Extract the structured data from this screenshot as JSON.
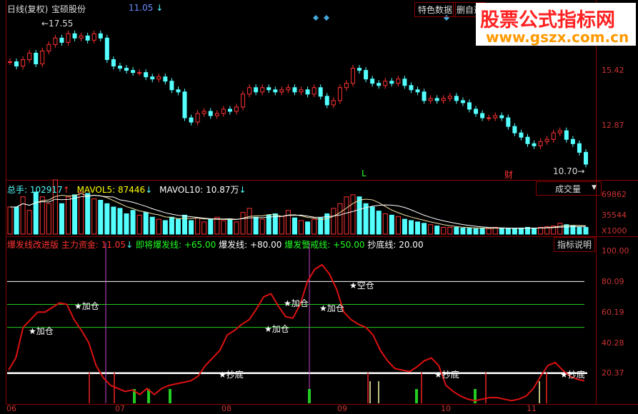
{
  "header": {
    "period": "日线(复权)",
    "stock_name": "宝硕股份",
    "price": "11.05",
    "price_arrow": "↓",
    "buttons": [
      "特色数据",
      "删自选"
    ]
  },
  "watermark": {
    "title": "股票公式指标网",
    "url": "www.gszx.com.cn"
  },
  "price_panel": {
    "high_label": "←17.55",
    "low_label": "10.70→",
    "axis": [
      "15.42",
      "12.87"
    ],
    "markers": {
      "L": "L",
      "cai": "财"
    }
  },
  "volume_panel": {
    "total_label": "总手:",
    "total": "102917",
    "total_arrow": "↑",
    "mavol5_label": "MAVOL5:",
    "mavol5": "87446",
    "mavol5_arrow": "↓",
    "mavol10_label": "MAVOL10:",
    "mavol10": "10.87万",
    "mavol10_arrow": "↓",
    "selector": "成交量",
    "axis": [
      "69862",
      "35544",
      "X1000"
    ]
  },
  "indicator_panel": {
    "name": "爆发线改进版",
    "main_fund_label": "主力资金:",
    "main_fund": "11.05",
    "main_fund_arrow": "↓",
    "near_label": "即将爆发线:",
    "near": "+65.00",
    "burst_label": "爆发线:",
    "burst": "+80.00",
    "warn_label": "爆发警戒线:",
    "warn": "+50.00",
    "bottom_label": "抄底线:",
    "bottom": "20.00",
    "help_button": "指标说明",
    "axis": [
      "100.00",
      "80.09",
      "60.19",
      "40.28",
      "20.37"
    ],
    "annotations": [
      "★加仓",
      "★加仓",
      "★抄底",
      "★加仓",
      "★加仓",
      "★加仓",
      "★空仓",
      "★抄底",
      "★抄底"
    ]
  },
  "x_axis": [
    "06",
    "07",
    "08",
    "09",
    "10",
    "11"
  ],
  "colors": {
    "up": "#ff3232",
    "down": "#54ffff",
    "line": "#dd1111",
    "axis": "#cc3333"
  },
  "chart_data": {
    "type": "candlestick",
    "closes": [
      15.8,
      15.6,
      15.9,
      16.2,
      15.7,
      16.3,
      16.6,
      16.9,
      16.7,
      17.1,
      16.9,
      17.0,
      16.8,
      17.1,
      16.9,
      15.9,
      15.6,
      15.5,
      15.4,
      15.3,
      15.3,
      15.1,
      15.0,
      15.1,
      14.9,
      14.5,
      14.4,
      13.2,
      13.0,
      13.4,
      13.5,
      13.3,
      13.4,
      13.6,
      13.5,
      13.7,
      14.3,
      14.6,
      14.4,
      14.6,
      14.5,
      14.4,
      14.5,
      14.6,
      14.4,
      14.5,
      14.3,
      14.6,
      14.2,
      13.8,
      14.0,
      14.6,
      14.8,
      15.5,
      15.4,
      15.0,
      14.8,
      14.7,
      14.9,
      14.8,
      15.0,
      14.7,
      14.5,
      14.4,
      14.0,
      14.1,
      14.0,
      14.1,
      14.2,
      14.0,
      13.9,
      13.6,
      13.4,
      13.2,
      13.2,
      13.3,
      13.2,
      12.8,
      12.5,
      12.3,
      12.0,
      11.9,
      12.1,
      12.2,
      12.5,
      12.6,
      12.2,
      12.0,
      11.6,
      11.05
    ],
    "volumes": [
      40,
      40,
      55,
      35,
      62,
      55,
      45,
      80,
      45,
      55,
      58,
      62,
      60,
      52,
      50,
      45,
      40,
      38,
      30,
      35,
      28,
      32,
      25,
      22,
      20,
      25,
      22,
      28,
      20,
      24,
      18,
      22,
      25,
      20,
      22,
      18,
      32,
      38,
      25,
      22,
      28,
      30,
      26,
      35,
      24,
      20,
      18,
      22,
      24,
      30,
      38,
      45,
      55,
      58,
      55,
      45,
      40,
      34,
      30,
      28,
      26,
      22,
      20,
      18,
      16,
      14,
      12,
      10,
      10,
      10,
      9,
      9,
      8,
      9,
      8,
      10,
      9,
      8,
      8,
      9,
      10,
      9,
      10,
      11,
      12,
      16,
      14,
      12,
      10,
      10
    ],
    "indicator": [
      22,
      30,
      50,
      55,
      60,
      60,
      63,
      66,
      65,
      55,
      48,
      40,
      25,
      17,
      12,
      10,
      8,
      9,
      6,
      10,
      6,
      10,
      12,
      13,
      14,
      15,
      18,
      25,
      30,
      35,
      45,
      48,
      52,
      55,
      62,
      70,
      72,
      64,
      57,
      56,
      65,
      80,
      88,
      91,
      85,
      75,
      60,
      55,
      52,
      50,
      45,
      35,
      28,
      23,
      22,
      21,
      24,
      28,
      30,
      25,
      12,
      8,
      5,
      3,
      2,
      3,
      4,
      4,
      3,
      2,
      3,
      5,
      10,
      18,
      25,
      27,
      22,
      18,
      16,
      15
    ],
    "ylim": [
      10.7,
      17.55
    ]
  }
}
